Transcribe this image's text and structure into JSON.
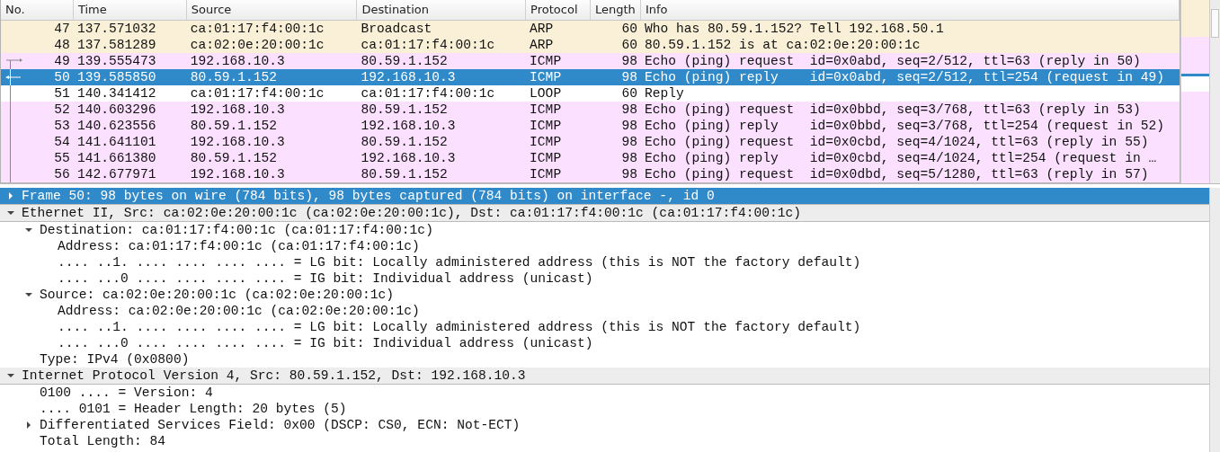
{
  "packet_list": {
    "columns": [
      "No.",
      "Time",
      "Source",
      "Destination",
      "Protocol",
      "Length",
      "Info"
    ],
    "rows": [
      {
        "no": "47",
        "time": "137.571032",
        "source": "ca:01:17:f4:00:1c",
        "destination": "Broadcast",
        "protocol": "ARP",
        "length": "60",
        "info": "Who has 80.59.1.152? Tell 192.168.50.1",
        "kind": "arp",
        "in_conversation": false,
        "linked_request": false,
        "selected": false
      },
      {
        "no": "48",
        "time": "137.581289",
        "source": "ca:02:0e:20:00:1c",
        "destination": "ca:01:17:f4:00:1c",
        "protocol": "ARP",
        "length": "60",
        "info": "80.59.1.152 is at ca:02:0e:20:00:1c",
        "kind": "arp",
        "in_conversation": false,
        "linked_request": false,
        "selected": false
      },
      {
        "no": "49",
        "time": "139.555473",
        "source": "192.168.10.3",
        "destination": "80.59.1.152",
        "protocol": "ICMP",
        "length": "98",
        "info": "Echo (ping) request  id=0x0abd, seq=2/512, ttl=63 (reply in 50)",
        "kind": "icmp",
        "in_conversation": true,
        "linked_request": true,
        "selected": false
      },
      {
        "no": "50",
        "time": "139.585850",
        "source": "80.59.1.152",
        "destination": "192.168.10.3",
        "protocol": "ICMP",
        "length": "98",
        "info": "Echo (ping) reply    id=0x0abd, seq=2/512, ttl=254 (request in 49)",
        "kind": "icmp",
        "in_conversation": true,
        "linked_request": false,
        "selected": true
      },
      {
        "no": "51",
        "time": "140.341412",
        "source": "ca:01:17:f4:00:1c",
        "destination": "ca:01:17:f4:00:1c",
        "protocol": "LOOP",
        "length": "60",
        "info": "Reply",
        "kind": "loop",
        "in_conversation": true,
        "linked_request": false,
        "selected": false
      },
      {
        "no": "52",
        "time": "140.603296",
        "source": "192.168.10.3",
        "destination": "80.59.1.152",
        "protocol": "ICMP",
        "length": "98",
        "info": "Echo (ping) request  id=0x0bbd, seq=3/768, ttl=63 (reply in 53)",
        "kind": "icmp",
        "in_conversation": true,
        "linked_request": false,
        "selected": false
      },
      {
        "no": "53",
        "time": "140.623556",
        "source": "80.59.1.152",
        "destination": "192.168.10.3",
        "protocol": "ICMP",
        "length": "98",
        "info": "Echo (ping) reply    id=0x0bbd, seq=3/768, ttl=254 (request in 52)",
        "kind": "icmp",
        "in_conversation": true,
        "linked_request": false,
        "selected": false
      },
      {
        "no": "54",
        "time": "141.641101",
        "source": "192.168.10.3",
        "destination": "80.59.1.152",
        "protocol": "ICMP",
        "length": "98",
        "info": "Echo (ping) request  id=0x0cbd, seq=4/1024, ttl=63 (reply in 55)",
        "kind": "icmp",
        "in_conversation": true,
        "linked_request": false,
        "selected": false
      },
      {
        "no": "55",
        "time": "141.661380",
        "source": "80.59.1.152",
        "destination": "192.168.10.3",
        "protocol": "ICMP",
        "length": "98",
        "info": "Echo (ping) reply    id=0x0cbd, seq=4/1024, ttl=254 (request in …",
        "kind": "icmp",
        "in_conversation": true,
        "linked_request": false,
        "selected": false
      },
      {
        "no": "56",
        "time": "142.677971",
        "source": "192.168.10.3",
        "destination": "80.59.1.152",
        "protocol": "ICMP",
        "length": "98",
        "info": "Echo (ping) request  id=0x0dbd, seq=5/1280, ttl=63 (reply in 57)",
        "kind": "icmp",
        "in_conversation": true,
        "linked_request": false,
        "selected": false
      }
    ]
  },
  "packet_details": [
    {
      "text": "Frame 50: 98 bytes on wire (784 bits), 98 bytes captured (784 bits) on interface -, id 0",
      "expanded": false,
      "selected": true
    },
    {
      "text": "Ethernet II, Src: ca:02:0e:20:00:1c (ca:02:0e:20:00:1c), Dst: ca:01:17:f4:00:1c (ca:01:17:f4:00:1c)",
      "expanded": true,
      "selected": false,
      "children": [
        {
          "text": "Destination: ca:01:17:f4:00:1c (ca:01:17:f4:00:1c)",
          "expanded": true,
          "selected": false,
          "children": [
            {
              "text": "Address: ca:01:17:f4:00:1c (ca:01:17:f4:00:1c)",
              "selected": false
            },
            {
              "text": ".... ..1. .... .... .... .... = LG bit: Locally administered address (this is NOT the factory default)",
              "selected": false
            },
            {
              "text": ".... ...0 .... .... .... .... = IG bit: Individual address (unicast)",
              "selected": false
            }
          ]
        },
        {
          "text": "Source: ca:02:0e:20:00:1c (ca:02:0e:20:00:1c)",
          "expanded": true,
          "selected": false,
          "children": [
            {
              "text": "Address: ca:02:0e:20:00:1c (ca:02:0e:20:00:1c)",
              "selected": false
            },
            {
              "text": ".... ..1. .... .... .... .... = LG bit: Locally administered address (this is NOT the factory default)",
              "selected": false
            },
            {
              "text": ".... ...0 .... .... .... .... = IG bit: Individual address (unicast)",
              "selected": false
            }
          ]
        },
        {
          "text": "Type: IPv4 (0x0800)",
          "selected": false
        }
      ]
    },
    {
      "text": "Internet Protocol Version 4, Src: 80.59.1.152, Dst: 192.168.10.3",
      "expanded": true,
      "selected": false,
      "children": [
        {
          "text": "0100 .... = Version: 4",
          "selected": false
        },
        {
          "text": ".... 0101 = Header Length: 20 bytes (5)",
          "selected": false
        },
        {
          "text": "Differentiated Services Field: 0x00 (DSCP: CS0, ECN: Not-ECT)",
          "expanded": false,
          "selected": false
        },
        {
          "text": "Total Length: 84",
          "selected": false
        }
      ]
    }
  ]
}
